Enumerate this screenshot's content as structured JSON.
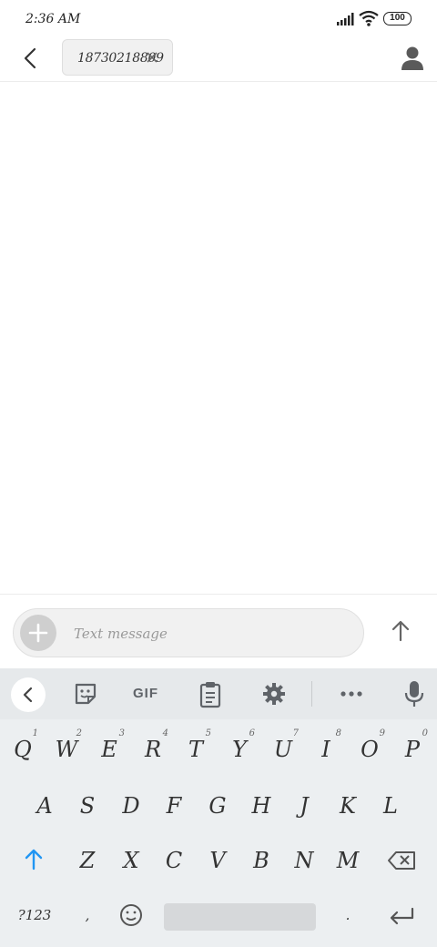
{
  "status_bar": {
    "time": "2:36 AM",
    "battery": "100"
  },
  "header": {
    "recipient": "18730218809"
  },
  "composer": {
    "placeholder": "Text message"
  },
  "keyboard": {
    "toolbar": {
      "gif_label": "GIF"
    },
    "row1": [
      {
        "char": "Q",
        "hint": "1"
      },
      {
        "char": "W",
        "hint": "2"
      },
      {
        "char": "E",
        "hint": "3"
      },
      {
        "char": "R",
        "hint": "4"
      },
      {
        "char": "T",
        "hint": "5"
      },
      {
        "char": "Y",
        "hint": "6"
      },
      {
        "char": "U",
        "hint": "7"
      },
      {
        "char": "I",
        "hint": "8"
      },
      {
        "char": "O",
        "hint": "9"
      },
      {
        "char": "P",
        "hint": "0"
      }
    ],
    "row2": [
      "A",
      "S",
      "D",
      "F",
      "G",
      "H",
      "J",
      "K",
      "L"
    ],
    "row3": [
      "Z",
      "X",
      "C",
      "V",
      "B",
      "N",
      "M"
    ],
    "symbols_label": "?123",
    "comma_label": ",",
    "period_label": "."
  },
  "colors": {
    "accent": "#2196f3",
    "keyboard_bg": "#eceff1",
    "icon": "#5f6368"
  }
}
